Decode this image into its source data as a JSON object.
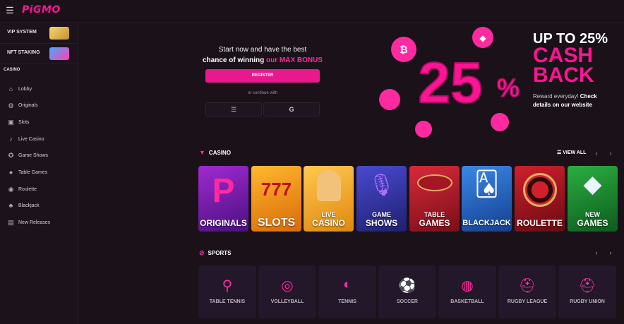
{
  "topbar": {
    "logo": "PiGMO",
    "menu_icon": "hamburger-icon"
  },
  "sidebar": {
    "promos": [
      {
        "label": "VIP SYSTEM",
        "image": "vip-chest-image"
      },
      {
        "label": "NFT STAKING",
        "image": "nft-cards-image"
      }
    ],
    "section_label": "CASINO",
    "items": [
      {
        "label": "Lobby",
        "icon": "lobby-icon"
      },
      {
        "label": "Originals",
        "icon": "originals-icon"
      },
      {
        "label": "Slots",
        "icon": "slots-icon"
      },
      {
        "label": "Live Casino",
        "icon": "microphone-icon"
      },
      {
        "label": "Game Shows",
        "icon": "game-shows-icon"
      },
      {
        "label": "Table Games",
        "icon": "cards-icon"
      },
      {
        "label": "Roulette",
        "icon": "roulette-icon"
      },
      {
        "label": "Blackjack",
        "icon": "blackjack-icon"
      },
      {
        "label": "New Releases",
        "icon": "gift-icon"
      }
    ]
  },
  "hero": {
    "line1": "Start now and have the best",
    "line2_prefix": "chance of winning ",
    "line2_accent": "our MAX BONUS",
    "register_label": "REGISTER",
    "continue_text": "or continue with",
    "auth_icons": [
      "wallet-icon",
      "google-icon"
    ],
    "promo_percent": "25",
    "promo_percent_sign": "%",
    "promo_title1": "UP TO 25%",
    "promo_title2": "CASH",
    "promo_title3": "BACK",
    "promo_desc_prefix": "Reward everyday! ",
    "promo_desc_bold": "Check details on our website",
    "accent_color": "#ff1493"
  },
  "casino": {
    "title": "CASINO",
    "view_all": "VIEW ALL",
    "cards": [
      {
        "label": "ORIGINALS",
        "bg": "#7a1fa0"
      },
      {
        "label": "SLOTS",
        "bg": "#f08a12"
      },
      {
        "label_small": "LIVE",
        "label": "CASINO",
        "bg": "#f0a020"
      },
      {
        "label_small": "GAME",
        "label": "SHOWS",
        "bg": "#2e3aa8"
      },
      {
        "label_small": "TABLE",
        "label": "GAMES",
        "bg": "#b0182a"
      },
      {
        "label": "BLACKJACK",
        "bg": "#1f5fbf"
      },
      {
        "label": "ROULETTE",
        "bg": "#a8141f"
      },
      {
        "label_small": "NEW",
        "label": "GAMES",
        "bg": "#1b8a2e"
      }
    ]
  },
  "sports": {
    "title": "SPORTS",
    "items": [
      {
        "label": "TABLE TENNIS",
        "icon": "table-tennis-icon"
      },
      {
        "label": "VOLLEYBALL",
        "icon": "volleyball-icon"
      },
      {
        "label": "TENNIS",
        "icon": "tennis-icon"
      },
      {
        "label": "SOCCER",
        "icon": "soccer-icon"
      },
      {
        "label": "BASKETBALL",
        "icon": "basketball-icon"
      },
      {
        "label": "RUGBY LEAGUE",
        "icon": "rugby-league-icon"
      },
      {
        "label": "RUGBY UNION",
        "icon": "rugby-union-icon"
      }
    ]
  }
}
